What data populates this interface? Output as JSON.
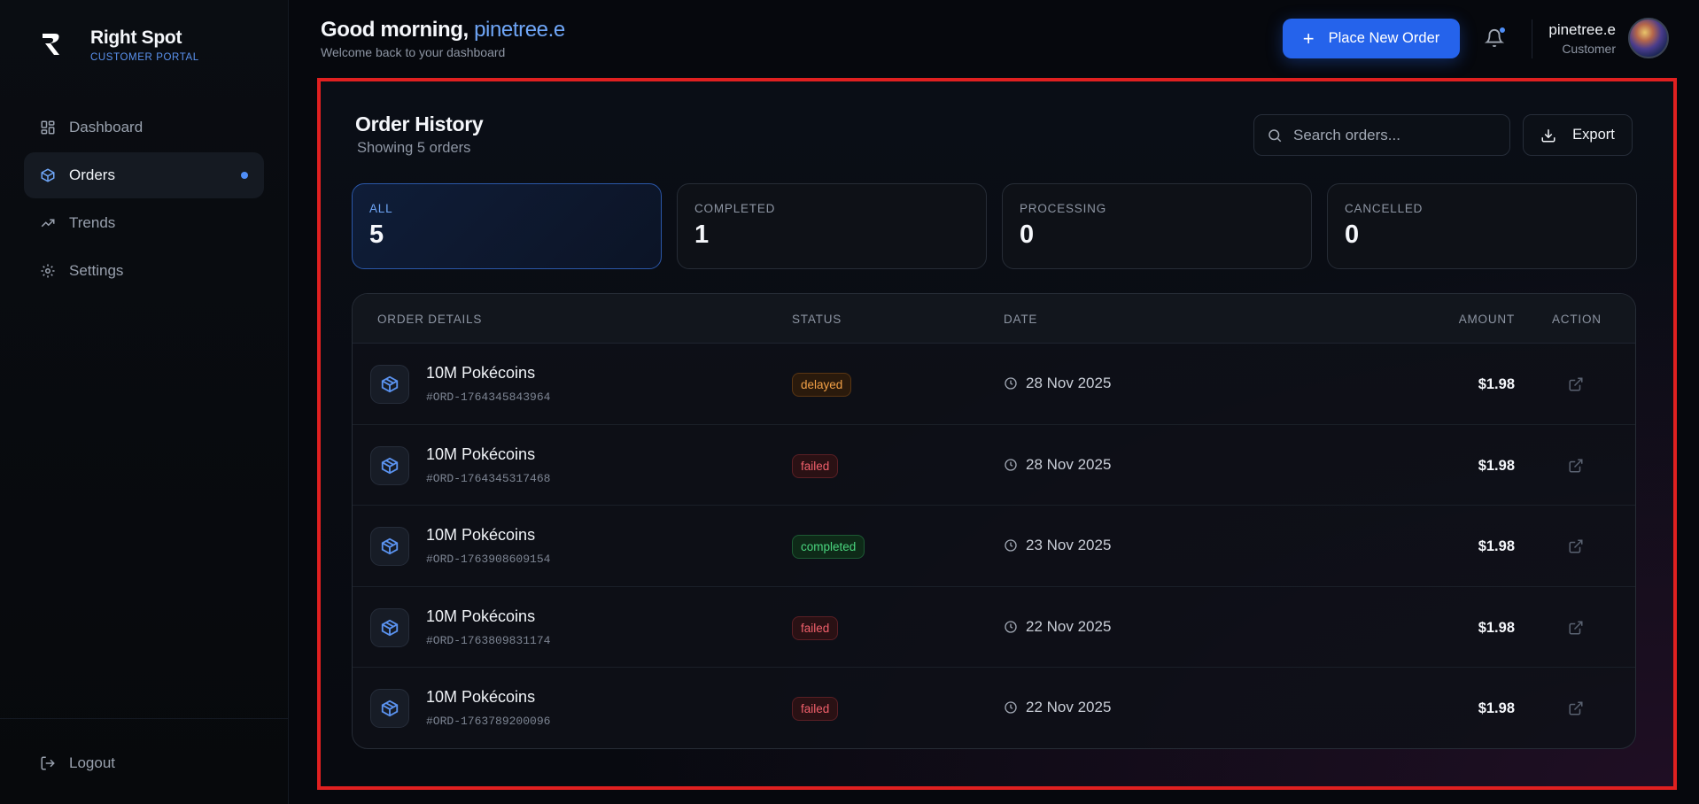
{
  "brand": {
    "name": "Right Spot",
    "subtitle": "CUSTOMER PORTAL"
  },
  "sidebar": {
    "items": [
      {
        "label": "Dashboard",
        "icon": "grid-icon",
        "active": false
      },
      {
        "label": "Orders",
        "icon": "package-icon",
        "active": true
      },
      {
        "label": "Trends",
        "icon": "trend-up-icon",
        "active": false
      },
      {
        "label": "Settings",
        "icon": "gear-icon",
        "active": false
      }
    ],
    "logout_label": "Logout"
  },
  "header": {
    "greeting": "Good morning,",
    "username": "pinetree.e",
    "subtitle": "Welcome back to your dashboard",
    "new_order_label": "Place New Order",
    "user_name": "pinetree.e",
    "user_role": "Customer"
  },
  "orders": {
    "title": "Order History",
    "subtitle": "Showing 5 orders",
    "search_placeholder": "Search orders...",
    "export_label": "Export",
    "stats": [
      {
        "label": "ALL",
        "value": "5"
      },
      {
        "label": "COMPLETED",
        "value": "1"
      },
      {
        "label": "PROCESSING",
        "value": "0"
      },
      {
        "label": "CANCELLED",
        "value": "0"
      }
    ],
    "columns": {
      "details": "ORDER DETAILS",
      "status": "STATUS",
      "date": "DATE",
      "amount": "AMOUNT",
      "action": "ACTION"
    },
    "rows": [
      {
        "name": "10M Pokécoins",
        "id": "#ORD-1764345843964",
        "status": "delayed",
        "date": "28 Nov 2025",
        "amount": "$1.98"
      },
      {
        "name": "10M Pokécoins",
        "id": "#ORD-1764345317468",
        "status": "failed",
        "date": "28 Nov 2025",
        "amount": "$1.98"
      },
      {
        "name": "10M Pokécoins",
        "id": "#ORD-1763908609154",
        "status": "completed",
        "date": "23 Nov 2025",
        "amount": "$1.98"
      },
      {
        "name": "10M Pokécoins",
        "id": "#ORD-1763809831174",
        "status": "failed",
        "date": "22 Nov 2025",
        "amount": "$1.98"
      },
      {
        "name": "10M Pokécoins",
        "id": "#ORD-1763789200096",
        "status": "failed",
        "date": "22 Nov 2025",
        "amount": "$1.98"
      }
    ]
  },
  "colors": {
    "accent": "#2563eb",
    "highlight": "#e02020",
    "delayed": "#f2a046",
    "failed": "#f0606b",
    "completed": "#4ad57e"
  }
}
